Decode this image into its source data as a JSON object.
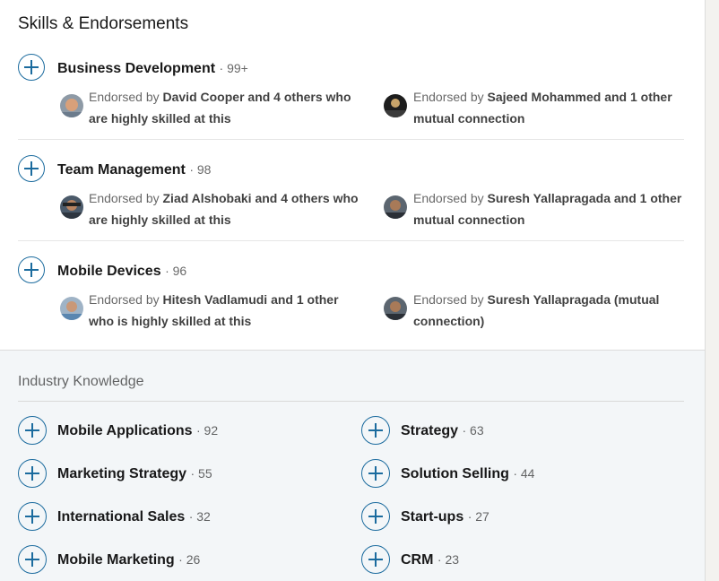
{
  "section_title": "Skills & Endorsements",
  "skills": [
    {
      "name": "Business Development",
      "count": "· 99+",
      "endorsements": [
        {
          "prefix": "Endorsed by ",
          "bold": "David Cooper and 4 others who are highly skilled at this"
        },
        {
          "prefix": "Endorsed by ",
          "bold": "Sajeed Mohammed and 1 other mutual connection"
        }
      ]
    },
    {
      "name": "Team Management",
      "count": "· 98",
      "endorsements": [
        {
          "prefix": "Endorsed by ",
          "bold": "Ziad Alshobaki and 4 others who are highly skilled at this"
        },
        {
          "prefix": "Endorsed by ",
          "bold": "Suresh Yallapragada and 1 other mutual connection"
        }
      ]
    },
    {
      "name": "Mobile Devices",
      "count": "· 96",
      "endorsements": [
        {
          "prefix": "Endorsed by ",
          "bold": "Hitesh Vadlamudi and 1 other who is highly skilled at this"
        },
        {
          "prefix": "Endorsed by ",
          "bold": "Suresh Yallapragada (mutual connection)"
        }
      ]
    }
  ],
  "industry": {
    "title": "Industry Knowledge",
    "items": [
      {
        "name": "Mobile Applications",
        "count": "· 92"
      },
      {
        "name": "Strategy",
        "count": "· 63"
      },
      {
        "name": "Marketing Strategy",
        "count": "· 55"
      },
      {
        "name": "Solution Selling",
        "count": "· 44"
      },
      {
        "name": "International Sales",
        "count": "· 32"
      },
      {
        "name": "Start-ups",
        "count": "· 27"
      },
      {
        "name": "Mobile Marketing",
        "count": "· 26"
      },
      {
        "name": "CRM",
        "count": "· 23"
      }
    ]
  },
  "colors": {
    "accent": "#1b6b9e",
    "gray_background": "#f3f6f8"
  }
}
